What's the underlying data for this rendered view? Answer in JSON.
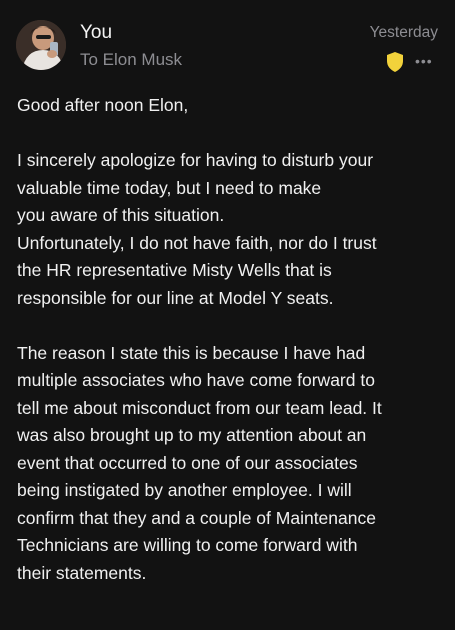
{
  "header": {
    "sender": "You",
    "recipient": "To Elon Musk",
    "timestamp": "Yesterday",
    "more_icon": "ellipsis-icon",
    "shield_icon": "shield-icon",
    "shield_color": "#f2d23b"
  },
  "message": {
    "greeting": "Good after noon Elon,",
    "para1": [
      "I sincerely apologize for having to disturb your",
      "valuable time today, but I need to make",
      "you aware of this situation.",
      "Unfortunately, I do not have faith, nor do I trust",
      "the HR representative Misty Wells that is",
      "responsible for our line at Model Y seats."
    ],
    "para2": [
      "The reason I state this is because I have had",
      "multiple associates who have come forward to",
      "tell me about misconduct from our team lead. It",
      "was also brought up to my attention about an",
      "event that occurred to one of our associates",
      "being instigated by another employee. I will",
      "confirm that they and a couple of Maintenance",
      "Technicians are willing to come forward with",
      "their statements."
    ]
  }
}
